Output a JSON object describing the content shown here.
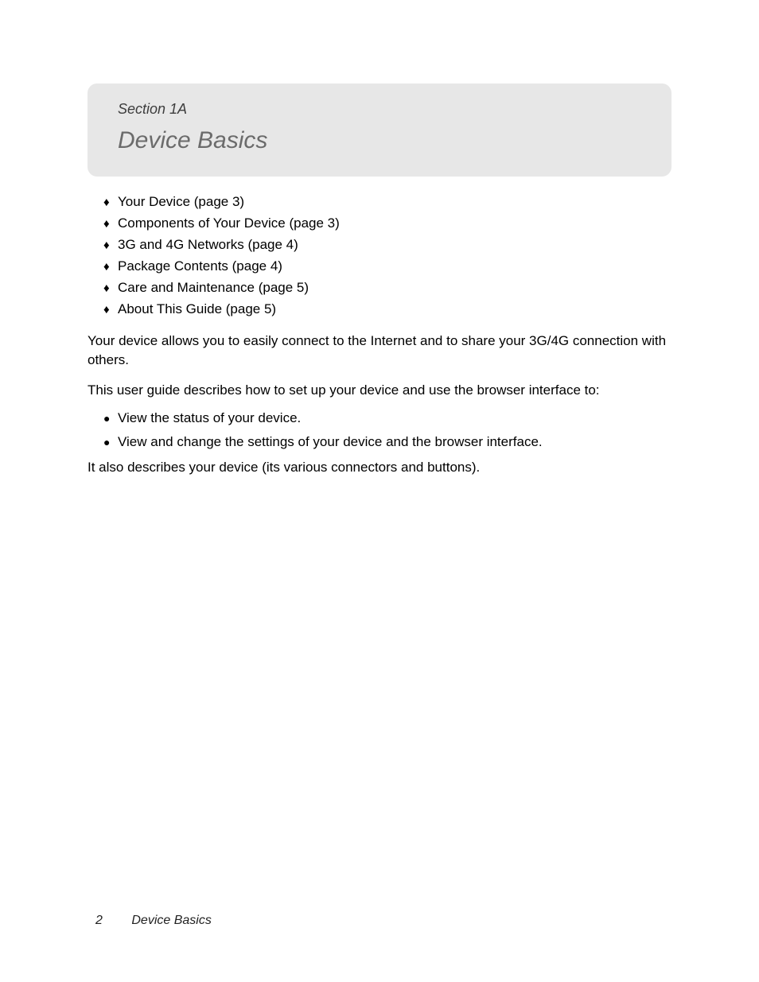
{
  "header": {
    "section_label": "Section 1A",
    "title": "Device Basics"
  },
  "toc": [
    "Your Device (page 3)",
    "Components of Your Device (page 3)",
    "3G and 4G Networks (page 4)",
    "Package Contents (page 4)",
    "Care and Maintenance (page 5)",
    "About This Guide (page 5)"
  ],
  "paragraphs": {
    "p1": "Your device allows you to easily connect to the Internet and to share your 3G/4G connection with others.",
    "p2": "This user guide describes how to set up your device and use the browser interface to:",
    "p3": "It also describes your device (its various connectors and buttons)."
  },
  "bullets": [
    "View the status of your device.",
    "View and change the settings of your device and the browser interface."
  ],
  "footer": {
    "page_number": "2",
    "title": "Device Basics"
  },
  "glyphs": {
    "diamond": "♦",
    "bullet": "●"
  }
}
